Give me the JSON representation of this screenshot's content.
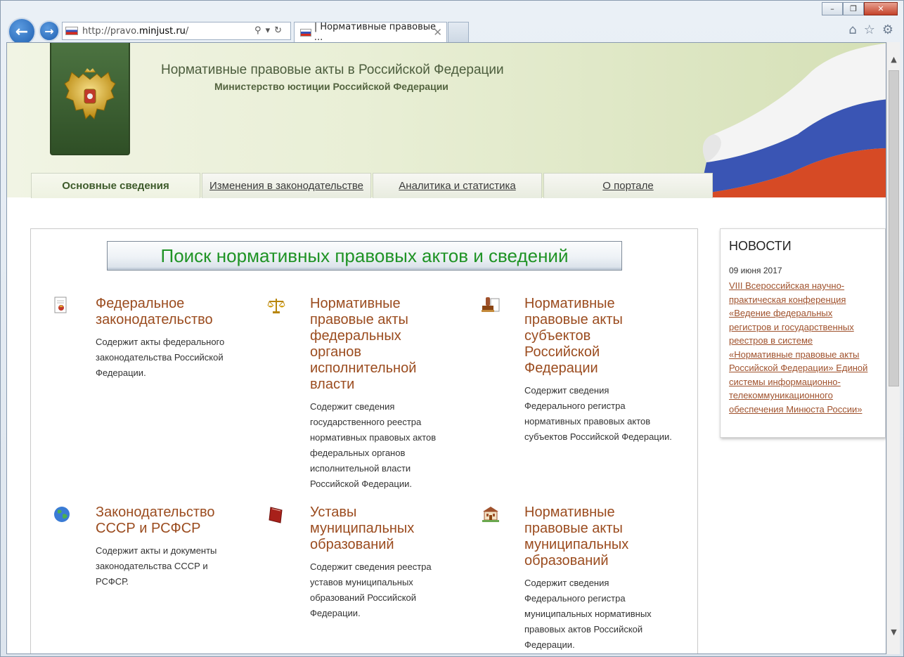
{
  "browser": {
    "url_prefix": "http://pravo.",
    "url_host": "minjust.ru",
    "url_suffix": "/",
    "tab_title": "| Нормативные правовые ...",
    "controls": {
      "minimize": "–",
      "restore": "❐",
      "close": "✕"
    },
    "icons": [
      "back-arrow-icon",
      "forward-arrow-icon",
      "search-icon",
      "refresh-icon",
      "home-icon",
      "star-icon",
      "gear-icon"
    ]
  },
  "header": {
    "title": "Нормативные правовые акты в Российской Федерации",
    "subtitle": "Министерство юстиции Российской Федерации"
  },
  "menu": [
    {
      "label": "Основные сведения",
      "active": true
    },
    {
      "label": "Изменения в законодательстве",
      "active": false
    },
    {
      "label": "Аналитика и статистика",
      "active": false
    },
    {
      "label": "О портале",
      "active": false
    }
  ],
  "main": {
    "search_banner": "Поиск нормативных правовых актов и сведений",
    "categories": [
      {
        "icon": "document-icon",
        "title": "Федеральное законодательство",
        "desc": "Содержит акты федерального законодательства Российской Федерации."
      },
      {
        "icon": "scales-icon",
        "title": "Нормативные правовые акты федеральных органов исполнительной власти",
        "desc": "Содержит сведения государственного реестра нормативных правовых актов федеральных органов исполнительной власти Российской Федерации."
      },
      {
        "icon": "stamp-icon",
        "title": "Нормативные правовые акты субъектов Российской Федерации",
        "desc": "Содержит сведения Федерального регистра нормативных правовых актов субъектов Российской Федерации."
      },
      {
        "icon": "globe-icon",
        "title": "Законодательство СССР и РСФСР",
        "desc": "Содержит акты и документы законодательства СССР и РСФСР."
      },
      {
        "icon": "book-icon",
        "title": "Уставы муниципальных образований",
        "desc": "Содержит сведения реестра уставов муниципальных образований Российской Федерации."
      },
      {
        "icon": "building-icon",
        "title": "Нормативные правовые акты муниципальных образований",
        "desc": "Содержит сведения Федерального регистра муниципальных нормативных правовых актов Российской Федерации."
      }
    ]
  },
  "news": {
    "title": "НОВОСТИ",
    "date": "09 июня 2017",
    "link": "VIII Всероссийская научно-практическая конференция «Ведение федеральных регистров и государственных реестров в системе «Нормативные правовые акты Российской Федерации» Единой системы информационно-телекоммуникационного обеспечения Минюста России»"
  }
}
